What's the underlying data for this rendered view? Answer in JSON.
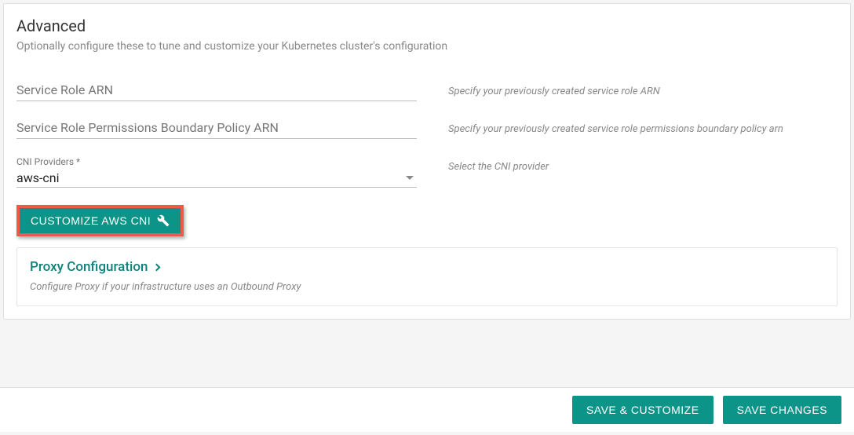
{
  "card": {
    "title": "Advanced",
    "subtitle": "Optionally configure these to tune and customize your Kubernetes cluster's configuration"
  },
  "fields": {
    "serviceRoleArn": {
      "placeholder": "Service Role ARN",
      "hint": "Specify your previously created service role ARN"
    },
    "permissionsBoundary": {
      "placeholder": "Service Role Permissions Boundary Policy ARN",
      "hint": "Specify your previously created service role permissions boundary policy arn"
    },
    "cniProviders": {
      "label": "CNI Providers *",
      "value": "aws-cni",
      "hint": "Select the CNI provider"
    }
  },
  "buttons": {
    "customizeCni": "CUSTOMIZE AWS CNI"
  },
  "expansion": {
    "title": "Proxy Configuration",
    "subtitle": "Configure Proxy if your infrastructure uses an Outbound Proxy"
  },
  "footer": {
    "saveCustomize": "SAVE & CUSTOMIZE",
    "saveChanges": "SAVE CHANGES"
  }
}
